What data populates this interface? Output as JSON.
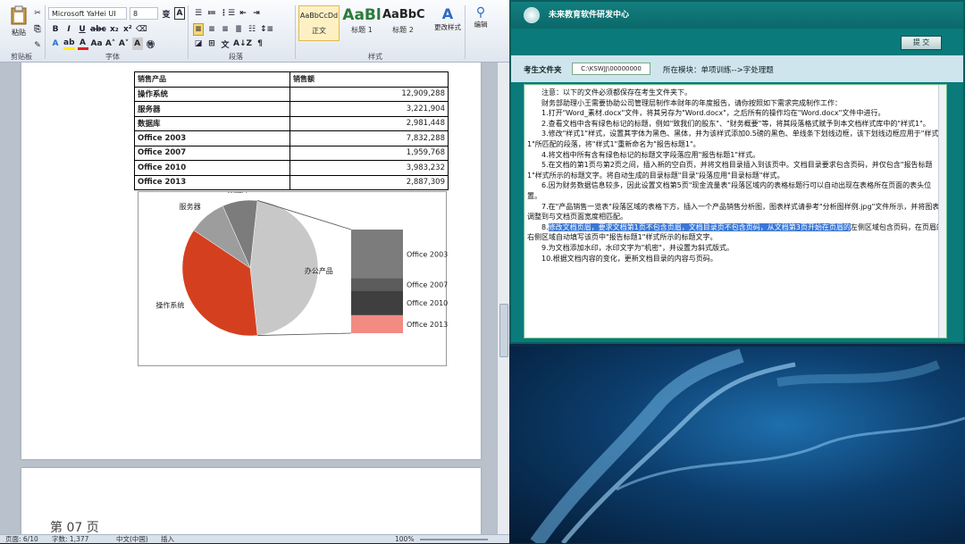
{
  "ribbon": {
    "font_name": "Microsoft YaHei UI",
    "font_size": "8",
    "paste_label": "粘贴",
    "groups": [
      "剪贴板",
      "字体",
      "段落",
      "样式",
      "编辑"
    ],
    "styles": [
      {
        "sample": "AaBbCcDd",
        "label": "正文"
      },
      {
        "sample": "AaBl",
        "label": "标题 1"
      },
      {
        "sample": "AaBbC",
        "label": "标题 2"
      }
    ],
    "change_styles": "更改样式",
    "editing": "编辑"
  },
  "table": {
    "headers": [
      "销售产品",
      "销售额"
    ],
    "rows": [
      {
        "name": "操作系统",
        "value": "12,909,288"
      },
      {
        "name": "服务器",
        "value": "3,221,904"
      },
      {
        "name": "数据库",
        "value": "2,981,448"
      },
      {
        "name": "Office 2003",
        "value": "7,832,288"
      },
      {
        "name": "Office 2007",
        "value": "1,959,768"
      },
      {
        "name": "Office 2010",
        "value": "3,983,232"
      },
      {
        "name": "Office 2013",
        "value": "2,887,309"
      }
    ]
  },
  "chart_data": {
    "type": "pie",
    "categories": [
      "办公产品",
      "操作系统",
      "服务器",
      "数据库"
    ],
    "values": [
      16662597,
      12909288,
      3221904,
      2981448
    ],
    "colors": [
      "#c8c8c8",
      "#d4401f",
      "#9d9d9d",
      "#7c7c7c"
    ],
    "breakdown": {
      "categories": [
        "Office 2003",
        "Office 2007",
        "Office 2010",
        "Office 2013"
      ],
      "values": [
        7832288,
        1959768,
        3983232,
        2887309
      ],
      "colors": [
        "#7c7c7c",
        "#5c5c5c",
        "#3f3f3f",
        "#f28b82"
      ]
    }
  },
  "page_footer": "第 07 页",
  "status": {
    "page": "页面: 6/10",
    "words": "字数: 1,377",
    "lang": "中文(中国)",
    "mode": "插入",
    "zoom": "100%"
  },
  "exam": {
    "title": "未来教育软件研发中心",
    "submit": "提 交",
    "folder_label": "考生文件夹",
    "folder_path": "C:\\KSWJJ\\00000000",
    "module": "所在模块：单项训练-->字处理题",
    "lines": [
      "注意：以下的文件必须都保存在考生文件夹下。",
      "财务部助理小王需要协助公司管理层制作本财年的年度报告，请你按照如下需求完成制作工作：",
      "1.打开\"Word_素材.docx\"文件，将其另存为\"Word.docx\"，之后所有的操作均在\"Word.docx\"文件中进行。",
      "2.查看文档中含有绿色标记的标题，例如\"致我们的股东\"、\"财务概要\"等，将其段落格式赋予到本文档样式库中的\"样式1\"。",
      "3.修改\"样式1\"样式，设置其字体为黑色、黑体，并为该样式添加0.5磅的黑色、单线条下划线边框，该下划线边框应用于\"样式1\"所匹配的段落，将\"样式1\"重新命名为\"报告标题1\"。",
      "4.将文档中所有含有绿色标记的标题文字段落应用\"报告标题1\"样式。",
      "5.在文档的第1页与第2页之间，插入新的空白页，并将文档目录插入到该页中。文档目录要求包含页码，并仅包含\"报告标题1\"样式所示的标题文字。将自动生成的目录标题\"目录\"段落应用\"目录标题\"样式。",
      "6.因为财务数据信息较多，因此设置文档第5页\"现金流量表\"段落区域内的表格标题行可以自动出现在表格所在页面的表头位置。",
      "7.在\"产品销售一览表\"段落区域的表格下方，插入一个产品销售分析图，图表样式请参考\"分析图样例.jpg\"文件所示，并将图表调整到与文档页面宽度相匹配。",
      "9.为文档添加水印，水印文字为\"机密\"，并设置为斜式版式。",
      "10.根据文档内容的变化，更新文档目录的内容与页码。"
    ],
    "line8_prefix": "8.",
    "line8_highlight": "修改文档页眉，要求文档第1页不包含页眉，文档目录页不包含页码，从文档第3页开始在页眉的",
    "line8_rest": "左侧区域包含页码，在页眉的右侧区域自动填写该页中\"报告标题1\"样式所示的标题文字。"
  }
}
